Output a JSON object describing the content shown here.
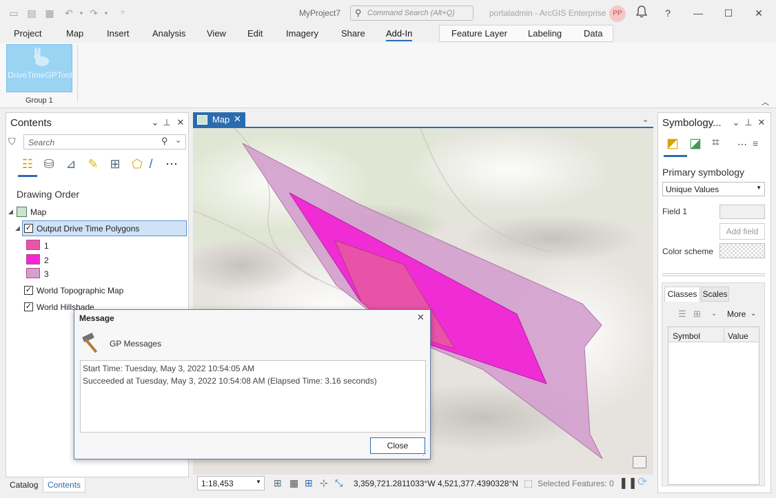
{
  "window": {
    "project_name": "MyProject7",
    "command_search_placeholder": "Command Search (Alt+Q)",
    "portal_text": "portaladmin - ArcGIS Enterprise",
    "avatar_initials": "PP",
    "help": "?",
    "minimize": "—",
    "maximize": "☐",
    "close": "✕"
  },
  "ribbon_tabs": [
    "Project",
    "Map",
    "Insert",
    "Analysis",
    "View",
    "Edit",
    "Imagery",
    "Share",
    "Add-In"
  ],
  "context_tabs": [
    "Feature Layer",
    "Labeling",
    "Data"
  ],
  "ribbon": {
    "tool_label": "DriveTimeGPTool",
    "group_label": "Group 1"
  },
  "contents": {
    "title": "Contents",
    "search_placeholder": "Search",
    "drawing_order": "Drawing Order",
    "map_label": "Map",
    "layer_label": "Output Drive Time Polygons",
    "legend": [
      {
        "label": "1",
        "color": "#e855a6"
      },
      {
        "label": "2",
        "color": "#f226d6"
      },
      {
        "label": "3",
        "color": "#d4a0cf"
      }
    ],
    "basemaps": [
      "World Topographic Map",
      "World Hillshade"
    ],
    "bottom_tabs": [
      "Catalog",
      "Contents"
    ]
  },
  "map": {
    "tab_label": "Map",
    "scale": "1:18,453",
    "coordinates": "3,359,721.2811033°W 4,521,377.4390328°N",
    "selected_features": "Selected Features: 0"
  },
  "symbology": {
    "title": "Symbology...",
    "primary_label": "Primary symbology",
    "method": "Unique Values",
    "field_label": "Field 1",
    "add_field": "Add field",
    "color_scheme_label": "Color scheme",
    "tabs": [
      "Classes",
      "Scales"
    ],
    "more": "More",
    "columns": [
      "Symbol",
      "Value"
    ]
  },
  "dialog": {
    "title": "Message",
    "heading": "GP Messages",
    "messages": [
      "Start Time: Tuesday, May 3, 2022 10:54:05 AM",
      "Succeeded at Tuesday, May 3, 2022 10:54:08 AM (Elapsed Time: 3.16 seconds)"
    ],
    "close_label": "Close"
  },
  "colors": {
    "accent": "#2b6cb0",
    "polygon_1": "#e855a6",
    "polygon_2": "#f226d6",
    "polygon_3": "#d4a0cf"
  }
}
